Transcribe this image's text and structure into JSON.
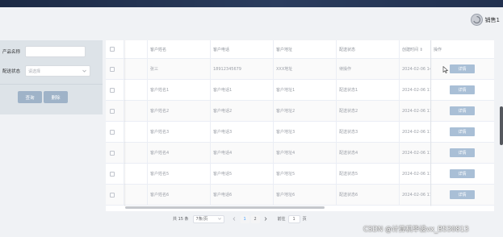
{
  "header": {
    "user_name": "销售1"
  },
  "filter": {
    "product_label": "产品名称",
    "product_value": "",
    "status_label": "配送状态",
    "status_placeholder": "请选择",
    "search_button": "查询",
    "delete_button": "删除"
  },
  "table": {
    "columns": [
      "",
      "",
      "客户姓名",
      "客户电话",
      "客户地址",
      "配送状态",
      "创建时间 ⇕",
      "操作"
    ],
    "rows": [
      {
        "name": "张三",
        "phone": "18912345679",
        "address": "XXX地址",
        "status": "待操作",
        "created": "2024-02-06 14",
        "action": "详情"
      },
      {
        "name": "客户姓名1",
        "phone": "客户电话1",
        "address": "客户地址1",
        "status": "配送状态1",
        "created": "2024-02-06 11",
        "action": "详情"
      },
      {
        "name": "客户姓名2",
        "phone": "客户电话2",
        "address": "客户地址2",
        "status": "配送状态2",
        "created": "2024-02-06 11",
        "action": "详情"
      },
      {
        "name": "客户姓名3",
        "phone": "客户电话3",
        "address": "客户地址3",
        "status": "配送状态3",
        "created": "2024-02-06 11",
        "action": "详情"
      },
      {
        "name": "客户姓名4",
        "phone": "客户电话4",
        "address": "客户地址4",
        "status": "配送状态4",
        "created": "2024-02-06 11",
        "action": "详情"
      },
      {
        "name": "客户姓名5",
        "phone": "客户电话5",
        "address": "客户地址5",
        "status": "配送状态5",
        "created": "2024-02-06 11",
        "action": "详情"
      },
      {
        "name": "客户姓名6",
        "phone": "客户电话6",
        "address": "客户地址6",
        "status": "配送状态6",
        "created": "2024-02-06 11",
        "action": "详情"
      }
    ]
  },
  "pagination": {
    "total_text": "共 15 条",
    "page_size": "7条/页",
    "pages": [
      "1",
      "2"
    ],
    "current_page": "1",
    "goto_label": "前往",
    "goto_value": "1",
    "page_suffix": "页"
  },
  "watermark": "CSDN @计算机毕设vx_B530813",
  "colors": {
    "accent": "#409eff",
    "button": "#9fb3c8",
    "topbar": "#1c2a45"
  }
}
